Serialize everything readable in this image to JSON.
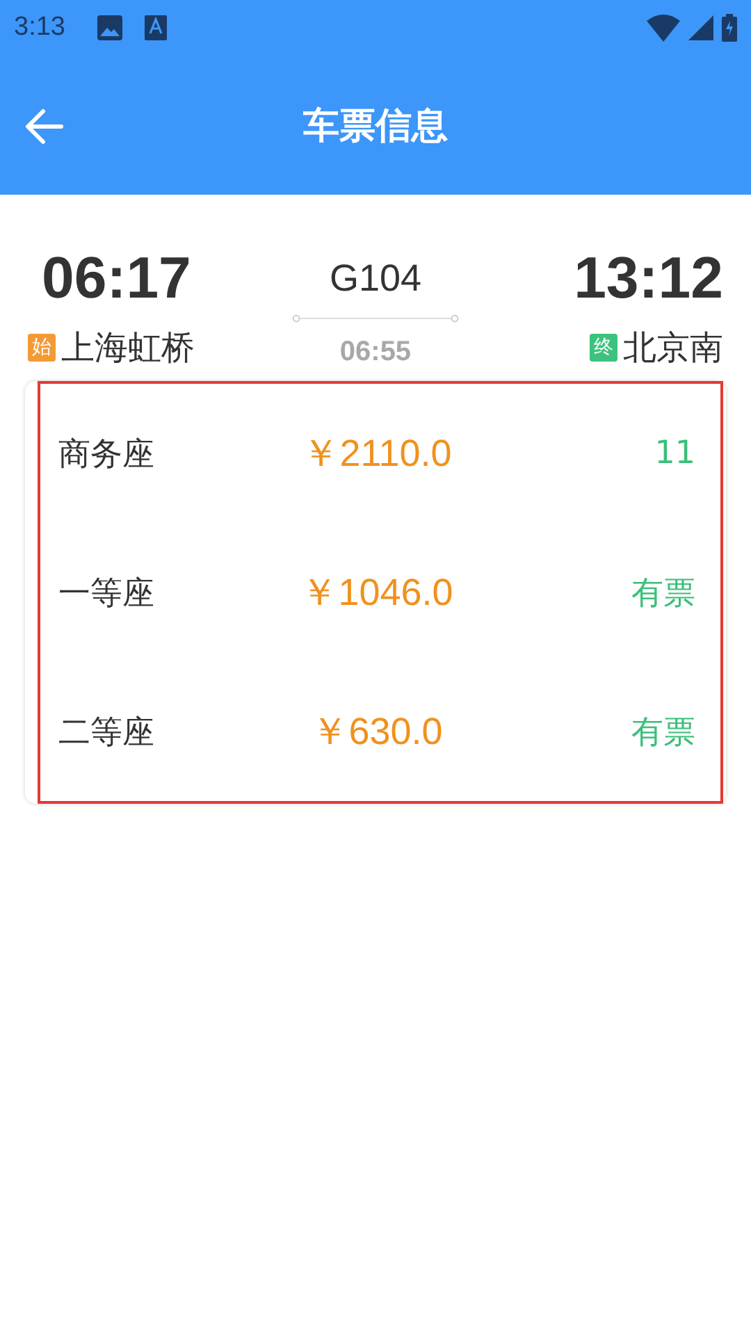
{
  "status_bar": {
    "time": "3:13"
  },
  "app_bar": {
    "title": "车票信息"
  },
  "train": {
    "departure_time": "06:17",
    "number": "G104",
    "duration": "06:55",
    "arrival_time": "13:12",
    "departure_badge": "始",
    "departure_station": "上海虹桥",
    "arrival_badge": "终",
    "arrival_station": "北京南"
  },
  "seats": [
    {
      "class": "商务座",
      "price": "￥2110.0",
      "availability": "11"
    },
    {
      "class": "一等座",
      "price": "￥1046.0",
      "availability": "有票"
    },
    {
      "class": "二等座",
      "price": "￥630.0",
      "availability": "有票"
    }
  ]
}
